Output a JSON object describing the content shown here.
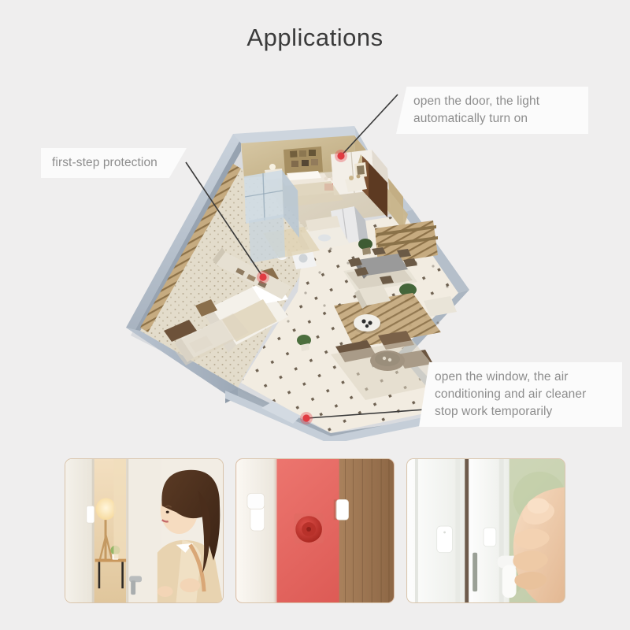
{
  "page": {
    "title": "Applications",
    "background_color": "#efeeee",
    "title_color": "#3b3b3b"
  },
  "callouts": [
    {
      "id": "first-step-protection",
      "text": "first-step protection",
      "position": "left",
      "marker_color": "#e8434a"
    },
    {
      "id": "door-light",
      "text": "open the door, the light\nautomatically turn on",
      "position": "top-right",
      "marker_color": "#e8434a"
    },
    {
      "id": "window-air",
      "text": "open the window, the air\nconditioning and air cleaner\nstop work temporarily",
      "position": "bottom-right",
      "marker_color": "#e8434a"
    }
  ],
  "illustration": {
    "name": "isometric-apartment-floorplan",
    "wall_color": "#b9c2cd",
    "floor_color": "#efe8dc",
    "accent_wood": "#a98b63"
  },
  "photos": [
    {
      "id": "photo-door-person",
      "caption_alt": "woman opening white door with lamp lit inside",
      "sensor_color": "#ffffff",
      "wall_color": "#f1ece4"
    },
    {
      "id": "photo-door-sensor-red-wall",
      "caption_alt": "door sensor pair mounted on white door beside red wall and wooden door",
      "sensor_color": "#ffffff",
      "wall_color": "#e8645f"
    },
    {
      "id": "photo-window-hand",
      "caption_alt": "hand opening white window with sensor attached",
      "sensor_color": "#ffffff",
      "wall_color": "#f3f4f2"
    }
  ]
}
